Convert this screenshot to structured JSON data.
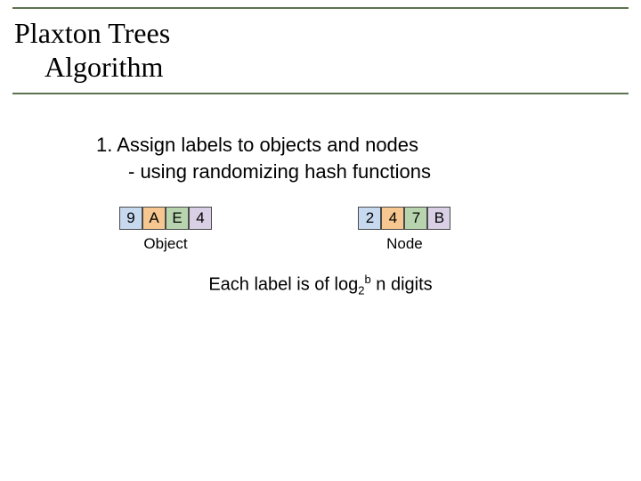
{
  "title": {
    "line1": "Plaxton Trees",
    "line2": "Algorithm"
  },
  "step": {
    "main": "1. Assign labels to objects and nodes",
    "sub": "- using randomizing hash functions"
  },
  "object_block": {
    "cells": [
      "9",
      "A",
      "E",
      "4"
    ],
    "caption": "Object"
  },
  "node_block": {
    "cells": [
      "2",
      "4",
      "7",
      "B"
    ],
    "caption": "Node"
  },
  "footnote": {
    "prefix": "Each label is of log",
    "sub": "2",
    "sup": "b",
    "suffix": " n digits"
  },
  "colors": {
    "rule": "#5c7350",
    "blue": "#c7d9ef",
    "orange": "#f6c790",
    "green": "#b8d4af",
    "lav": "#d9d0e6"
  }
}
